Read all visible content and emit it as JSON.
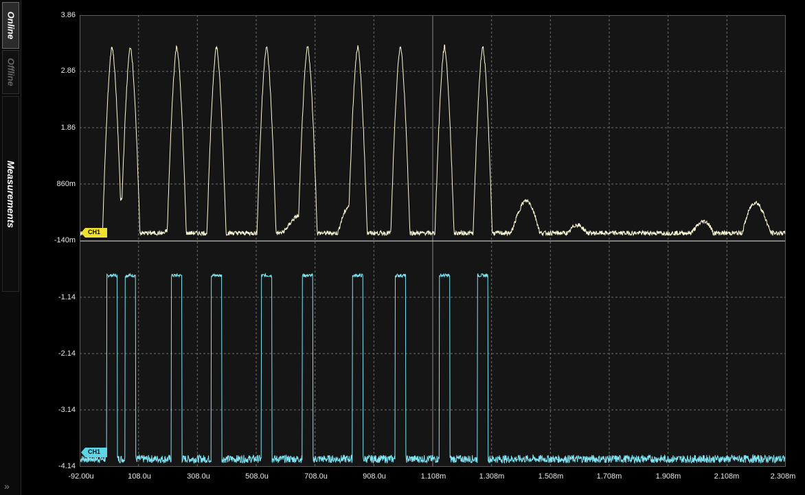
{
  "sidebar": {
    "tabs": [
      {
        "label": "Online",
        "state": "active"
      },
      {
        "label": "Offline",
        "state": "inactive"
      },
      {
        "label": "Measurements",
        "state": "normal"
      }
    ],
    "expand_icon": "double-chevron-right"
  },
  "plot": {
    "background": "#151515",
    "grid": true,
    "ch1_color": "#fffbd8",
    "ch2_color": "#7fe6f6"
  },
  "channels": [
    {
      "label": "CH1",
      "color": "#f0e030"
    },
    {
      "label": "CH1",
      "color": "#5cd6e6"
    }
  ],
  "y_ticks_top": [
    "3.86",
    "2.86",
    "1.86",
    "860m",
    "-140m"
  ],
  "y_ticks_bottom": [
    "-1.14",
    "-2.14",
    "-3.14",
    "-4.14"
  ],
  "x_ticks": [
    "-92.00u",
    "108.0u",
    "308.0u",
    "508.0u",
    "708.0u",
    "908.0u",
    "1.108m",
    "1.308m",
    "1.508m",
    "1.708m",
    "1.908m",
    "2.108m",
    "2.308m"
  ],
  "chart_data": {
    "type": "line",
    "x_range_s": [
      -9.2e-05,
      0.002308
    ],
    "pulse_starts_s": [
      0.0,
      6.25e-05,
      0.00022,
      0.000355,
      0.000525,
      0.000665,
      0.000835,
      0.00098,
      0.00113,
      0.00126
    ],
    "series": [
      {
        "label": "CH1",
        "ylim": [
          -0.14,
          3.86
        ],
        "high_level": 3.3,
        "low_level": -0.05
      },
      {
        "label": "CH1",
        "ylim": [
          -4.14,
          -0.14
        ],
        "high_level": -0.75,
        "low_level": -4.0
      }
    ]
  }
}
